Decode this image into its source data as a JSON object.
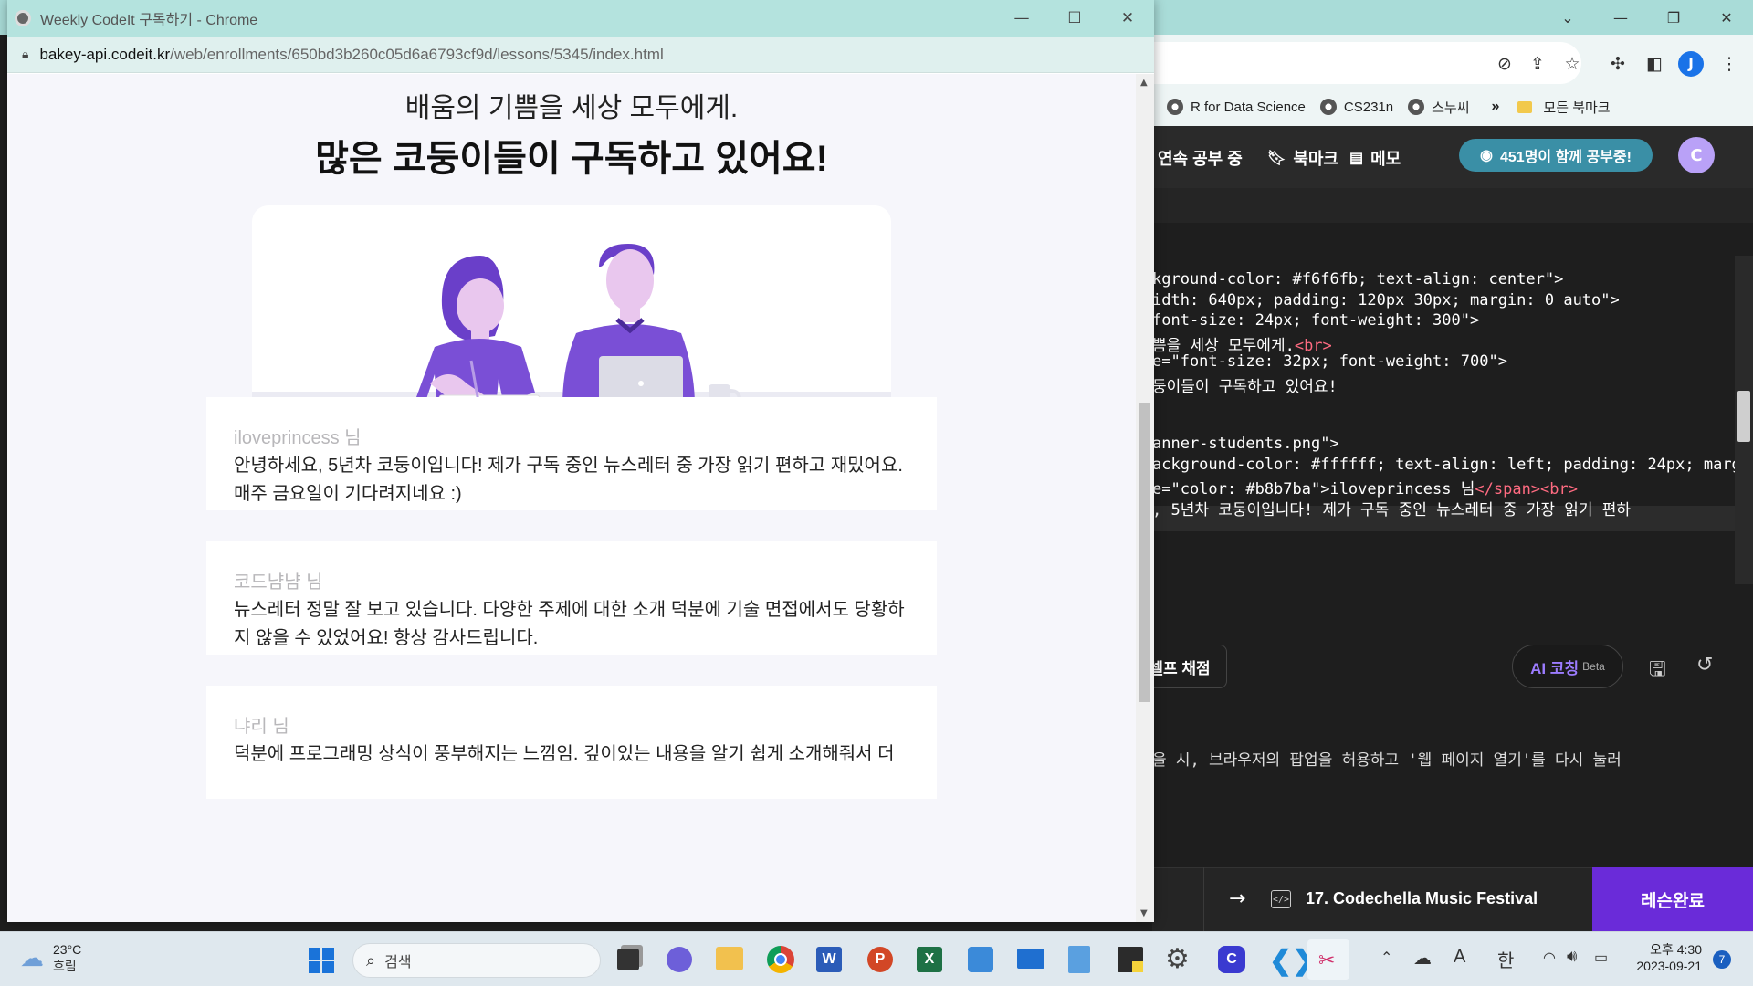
{
  "background_window": {
    "bookmarks": [
      "R for Data Science",
      "CS231n",
      "스누씨"
    ],
    "bookmarks_more": "»",
    "bookmark_folder": "모든 북마크",
    "profile_initial": "J",
    "nav": {
      "streak": "연속 공부 중",
      "bookmark": "북마크",
      "memo": "메모",
      "study_together": "451명이 함께 공부중!"
    },
    "code_lines": [
      "kground-color: #f6f6fb; text-align: center\">",
      "idth: 640px; padding: 120px 30px; margin: 0 auto\">",
      "font-size: 24px; font-weight: 300\">",
      "쁨을 세상 모두에게.",
      "e=\"font-size: 32px; font-weight: 700\">",
      "둥이들이 구독하고 있어요!",
      "anner-students.png\">",
      "ackground-color: #ffffff; text-align: left; padding: 24px; marg",
      "e=\"color: #b8b7ba\">iloveprincess 님",
      ", 5년차 코둥이입니다! 제가 구독 중인 뉴스레터 중 가장 읽기 편하"
    ],
    "code_tags": {
      "br": "<br>",
      "span_close": "</span>",
      "br2": "<br>"
    },
    "self_grade": "셀프 채점",
    "ai_coach": "AI 코칭",
    "ai_beta": "Beta",
    "console_message": "을 시, 브라우저의 팝업을 허용하고 '웹 페이지 열기'를 다시 눌러",
    "next_lesson": "17. Codechella Music Festival",
    "complete_button": "레슨완료"
  },
  "popup": {
    "title": "Weekly CodeIt 구독하기 - Chrome",
    "url_domain": "bakey-api.codeit.kr",
    "url_path": "/web/enrollments/650bd3b260c05d6a6793cf9d/lessons/5345/index.html",
    "headline_light": "배움의 기쁨을 세상 모두에게.",
    "headline_bold": "많은 코둥이들이 구독하고 있어요!",
    "reviews": [
      {
        "name": "iloveprincess 님",
        "text": "안녕하세요, 5년차 코둥이입니다! 제가 구독 중인 뉴스레터 중 가장 읽기 편하고 재밌어요. 매주 금요일이 기다려지네요 :)"
      },
      {
        "name": "코드냠냠 님",
        "text": "뉴스레터 정말 잘 보고 있습니다. 다양한 주제에 대한 소개 덕분에 기술 면접에서도 당황하지 않을 수 있었어요! 항상 감사드립니다."
      },
      {
        "name": "냐리 님",
        "text": "덕분에 프로그래밍 상식이 풍부해지는 느낌임. 깊이있는 내용을 알기 쉽게 소개해줘서 더"
      }
    ]
  },
  "taskbar": {
    "weather_temp": "23°C",
    "weather_desc": "흐림",
    "search_placeholder": "검색",
    "ime_a": "A",
    "ime_han": "한",
    "time": "오후 4:30",
    "date": "2023-09-21",
    "notification_count": "7"
  },
  "colors": {
    "accent_purple": "#6a2bd9",
    "pill_teal": "#3a8fa6",
    "review_name": "#b8b7ba",
    "page_bg": "#f6f6fb"
  }
}
